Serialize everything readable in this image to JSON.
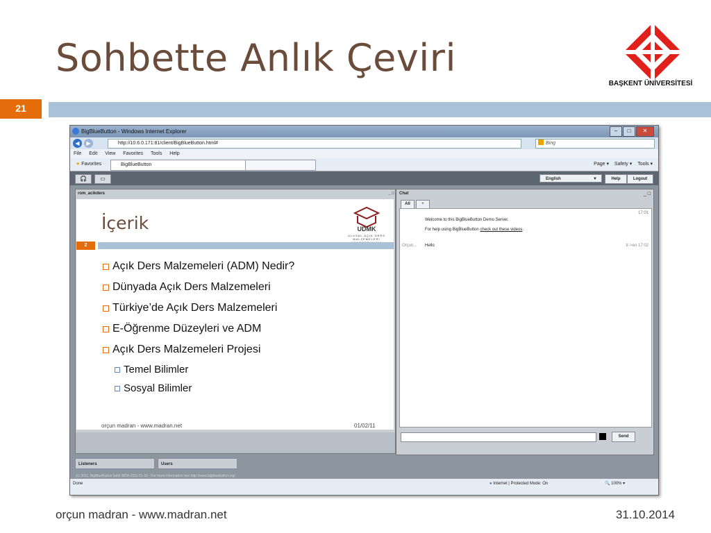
{
  "slide": {
    "title": "Sohbette Anlık Çeviri",
    "number": "21",
    "footer_left": "orçun madran - www.madran.net",
    "footer_right": "31.10.2014",
    "logo_text": "BAŞKENT ÜNİVERSİTESİ",
    "accent": "#e46c0a",
    "bar_color": "#a9c2d8"
  },
  "browser": {
    "title": "BigBlueButton - Windows Internet Explorer",
    "url": "http://10.6.0.171:81/client/BigBlueButton.html#",
    "search_placeholder": "Bing",
    "menu": [
      "File",
      "Edit",
      "View",
      "Favorites",
      "Tools",
      "Help"
    ],
    "favorites_label": "Favorites",
    "tab_label": "BigBlueButton",
    "tools": [
      "Page ▾",
      "Safety ▾",
      "Tools ▾"
    ],
    "status_done": "Done",
    "status_zone": "Internet | Protected Mode: On",
    "status_zoom": "100%"
  },
  "app": {
    "language": "English",
    "help": "Help",
    "logout": "Logout",
    "presentation_title": "rom_acikders",
    "inner_slide": {
      "title": "İçerik",
      "number": "2",
      "logo_text": "UDMK",
      "logo_sub": "ULUSAL AÇIK DERS MALZEMELERİ KONSORSİYUMU",
      "bullets": [
        "Açık Ders Malzemeleri (ADM) Nedir?",
        "Dünyada Açık Ders Malzemeleri",
        "Türkiye’de Açık Ders Malzemeleri",
        "E-Öğrenme Düzeyleri ve ADM",
        "Açık Ders Malzemeleri Projesi"
      ],
      "sub_bullets": [
        "Temel Bilimler",
        "Sosyal Bilimler"
      ],
      "footer_left": "orçun madran - www.madran.net",
      "footer_right": "01/02/11"
    },
    "chat": {
      "title": "Chat",
      "tab_all": "All",
      "tab_plus": "+",
      "time1": "17:01",
      "welcome": "Welcome to this BigBlueButton Demo Server.",
      "help_prefix": "For help using BigBlueButton ",
      "help_link": "check out these videos",
      "help_suffix": ".",
      "sender": "Orçun...",
      "message": "Hello",
      "translation_time": "tr->en 17:02",
      "send": "Send"
    },
    "listeners_tab": "Listeners",
    "users_tab": "Users",
    "copyright": "(c) 2011, BigBlueButton build 3818-2011-01-18 - For more information see http://www.bigbluebutton.org/."
  }
}
